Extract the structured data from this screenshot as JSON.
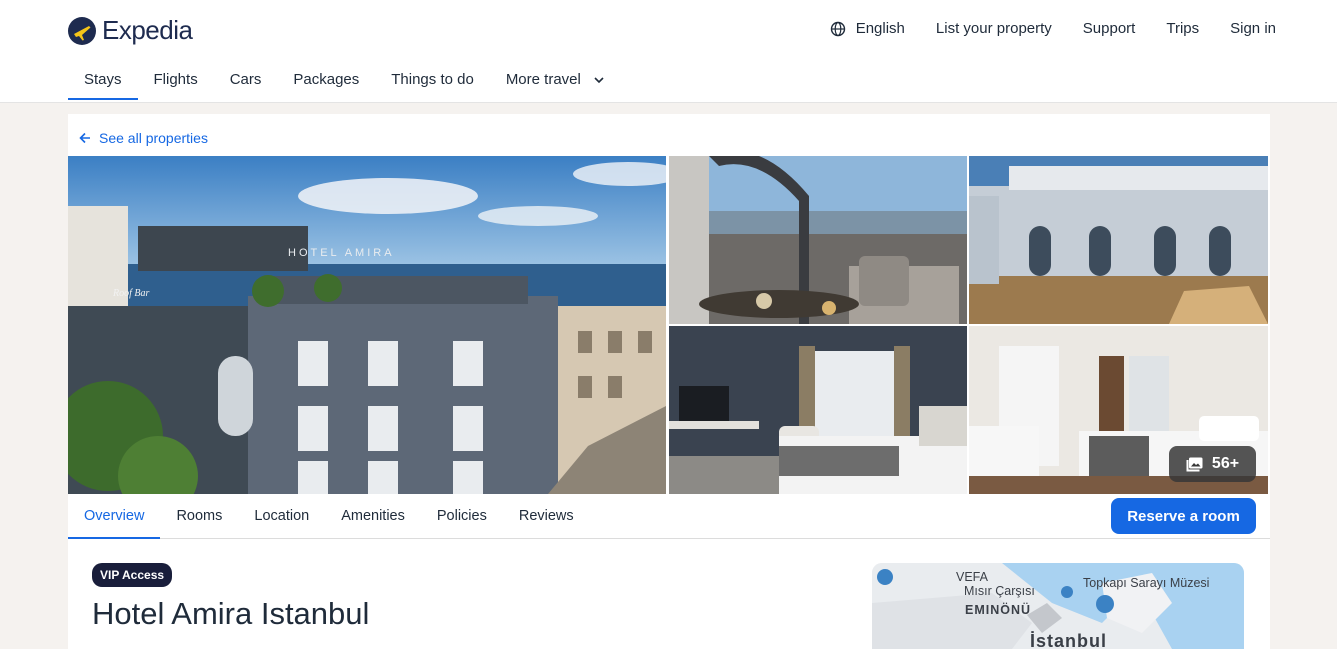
{
  "header": {
    "brand": "Expedia",
    "links": {
      "language": "English",
      "list_property": "List your property",
      "support": "Support",
      "trips": "Trips",
      "sign_in": "Sign in"
    },
    "nav": [
      {
        "label": "Stays"
      },
      {
        "label": "Flights"
      },
      {
        "label": "Cars"
      },
      {
        "label": "Packages"
      },
      {
        "label": "Things to do"
      },
      {
        "label": "More travel"
      }
    ]
  },
  "property": {
    "back_link": "See all properties",
    "photo_count": "56+",
    "tabs": [
      {
        "label": "Overview"
      },
      {
        "label": "Rooms"
      },
      {
        "label": "Location"
      },
      {
        "label": "Amenities"
      },
      {
        "label": "Policies"
      },
      {
        "label": "Reviews"
      }
    ],
    "reserve_label": "Reserve a room",
    "vip_badge": "VIP Access",
    "name": "Hotel Amira Istanbul",
    "main_photo_sign": "HOTEL AMIRA",
    "main_photo_bar_sign": "Roof Bar"
  },
  "map": {
    "labels": {
      "vefa": "VEFA",
      "misir": "Mısır Çarşısı",
      "topkapi": "Topkapı Sarayı Müzesi",
      "eminonu": "EMINÖNÜ",
      "istanbul": "İstanbul"
    }
  },
  "colors": {
    "accent": "#1668e3",
    "brand": "#1e2b4f",
    "vip": "#191e3b"
  }
}
